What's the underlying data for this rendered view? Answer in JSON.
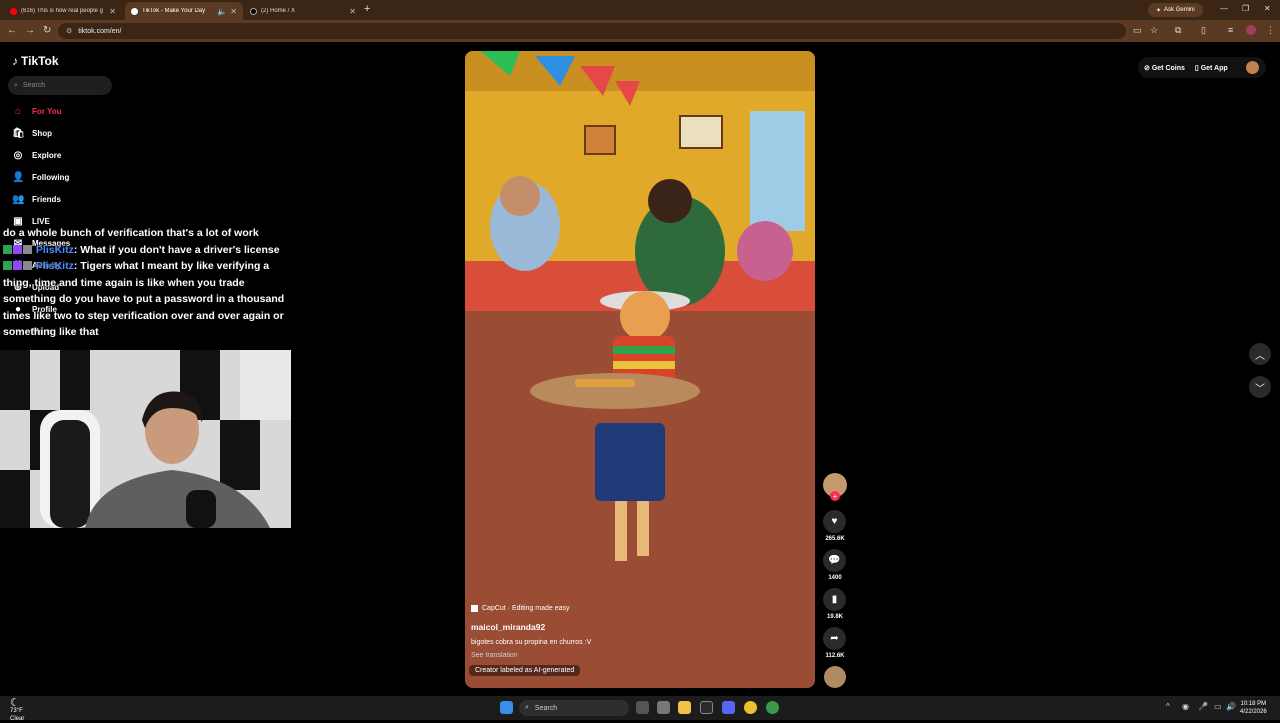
{
  "browser": {
    "tabs": [
      {
        "title": "(616) This is how real people g",
        "favicon_color": "#ff0000",
        "active": false
      },
      {
        "title": "TikTok - Make Your Day",
        "favicon_color": "#ffffff",
        "active": true
      },
      {
        "title": "(2) Home / X",
        "favicon_color": "#000000",
        "active": false
      }
    ],
    "url": "tiktok.com/en/",
    "gemini_label": "Ask Gemini"
  },
  "tiktok": {
    "logo_text": "TikTok",
    "search_placeholder": "Search",
    "nav": [
      {
        "label": "For You",
        "icon": "home-icon",
        "active": true
      },
      {
        "label": "Shop",
        "icon": "shop-icon"
      },
      {
        "label": "Explore",
        "icon": "compass-icon"
      },
      {
        "label": "Following",
        "icon": "following-icon"
      },
      {
        "label": "Friends",
        "icon": "friends-icon"
      },
      {
        "label": "LIVE",
        "icon": "live-icon"
      },
      {
        "label": "Messages",
        "icon": "messages-icon"
      },
      {
        "label": "Activity",
        "icon": "activity-icon"
      },
      {
        "label": "Upload",
        "icon": "upload-icon"
      },
      {
        "label": "Profile",
        "icon": "profile-icon"
      },
      {
        "label": "More",
        "icon": "more-icon"
      }
    ],
    "top_right": {
      "get_coins": "Get Coins",
      "get_app": "Get App"
    },
    "video": {
      "capcut_label": "CapCut · Editing made easy",
      "author": "maicol_miranda92",
      "caption": "bigotes cobra su propina en churros :V",
      "see_translation": "See translation",
      "ai_label": "Creator labeled as AI-generated"
    },
    "actions": {
      "likes": "265.6K",
      "comments": "1400",
      "saves": "19.8K",
      "shares": "112.6K"
    }
  },
  "chat": [
    {
      "name": "",
      "text": "do a whole bunch of verification that's a lot of work"
    },
    {
      "name": "PlisKitz",
      "text": ": What if you don't have a driver's license"
    },
    {
      "name": "PlisKitz",
      "text": ": Tigers what I meant by like verifying a thing, time and time again is like when you trade something do you have to put a password in a thousand times like two to step verification over and over again or something like that"
    }
  ],
  "taskbar": {
    "temperature": "73°F",
    "condition": "Clear",
    "search": "Search",
    "time": "10:18 PM",
    "date": "4/22/2026"
  }
}
